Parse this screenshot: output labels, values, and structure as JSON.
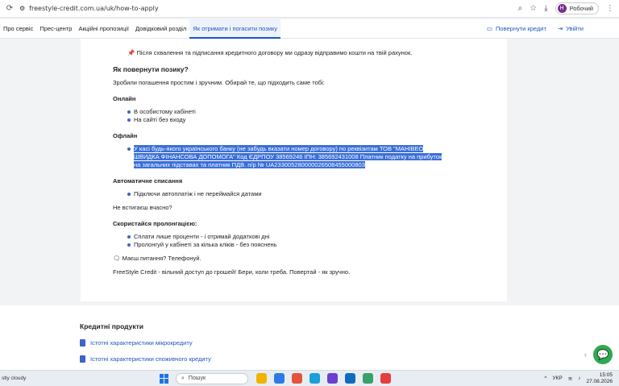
{
  "browser": {
    "url_host": "freestyle-credit.com.ua",
    "url_path": "/uk/how-to-apply",
    "profile_initial": "Н",
    "profile_label": "Робочий"
  },
  "nav": {
    "items": [
      "Про сервіс",
      "Прес-центр",
      "Акційні пропозиції",
      "Довідковий розділ",
      "Як отримати і погасити позику"
    ],
    "return_credit": "Повернути кредит",
    "login": "Увійти"
  },
  "content": {
    "partial_top": "... ",
    "pin_text": "Після схвалення та підписання кредитного договору ми одразу відправимо кошти на твій рахунок.",
    "how_return_title": "Як повернути позику?",
    "how_return_intro": "Зробили погашення простим і зручним. Обирай те, що підходить саме тобі:",
    "online_title": "Онлайн",
    "online_items": [
      "В особистому кабінеті",
      "На сайті без входу"
    ],
    "offline_title": "Офлайн",
    "offline_item": "У касі будь-якого українського банку (не забудь вказати номер договору) по реквізитам ТОВ \"МАНІВЕО ШВИДКА ФІНАНСОВА ДОПОМОГА\" Код ЄДРПОУ 38569246 ІПН: 385692431008 Платник податку на прибуток на загальних підставах та платник ПДВ. п/р № UA233005280000026508455000803",
    "auto_title": "Автоматичне списання",
    "auto_items": [
      "Підключи автоплатіж і не переймайся датами"
    ],
    "late_question": "Не встигаєш вчасно?",
    "prolong_title": "Скористайся пролонгацією:",
    "prolong_items": [
      "Сплати лише проценти - і отримай додаткові дні",
      "Пролонгуй у кабінеті за кілька кліків - без пояснень"
    ],
    "questions": "Маєш питання? Телефонуй.",
    "closing": "FreeStyle Credit - вільний доступ до грошей! Бери, коли треба. Повертай - як зручно."
  },
  "footer": {
    "title": "Кредитні продукти",
    "links": [
      "Істотні характеристики мікрокредиту",
      "Істотні характеристики споживчого кредиту"
    ]
  },
  "taskbar": {
    "weather": "stly cloudy",
    "search_label": "Пошук",
    "lang": "УКР",
    "time": "15:05",
    "date": "27.08.2026"
  },
  "colors": {
    "accent": "#1d57c4",
    "selection": "#3a6fd8",
    "chat": "#2fa84f"
  }
}
